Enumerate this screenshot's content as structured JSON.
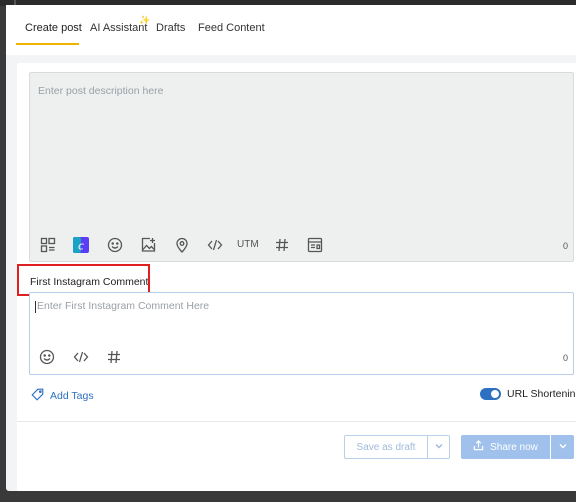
{
  "tabs": {
    "create_post": "Create post",
    "ai_assistant": "AI Assistant",
    "drafts": "Drafts",
    "feed_content": "Feed Content"
  },
  "description": {
    "placeholder": "Enter post description here",
    "char_count": "0",
    "toolbar": {
      "media_icon": "media-library-icon",
      "canva_icon": "canva-icon",
      "emoji_icon": "emoji-icon",
      "image_icon": "image-icon",
      "location_icon": "location-icon",
      "code_icon": "code-icon",
      "utm_label": "UTM",
      "hashtag_icon": "hashtag-icon",
      "template_icon": "template-icon"
    }
  },
  "first_comment": {
    "label": "First Instagram Comment",
    "placeholder": "Enter First Instagram Comment Here",
    "char_count": "0"
  },
  "tags": {
    "label": "Add Tags"
  },
  "url_shortening": {
    "label": "URL Shortening",
    "enabled": true
  },
  "actions": {
    "save_draft": "Save as draft",
    "share_now": "Share now"
  },
  "colors": {
    "accent": "#2d6fc0",
    "tab_underline": "#f0b400",
    "highlight": "#e02020",
    "canva": "#5b3df5"
  }
}
